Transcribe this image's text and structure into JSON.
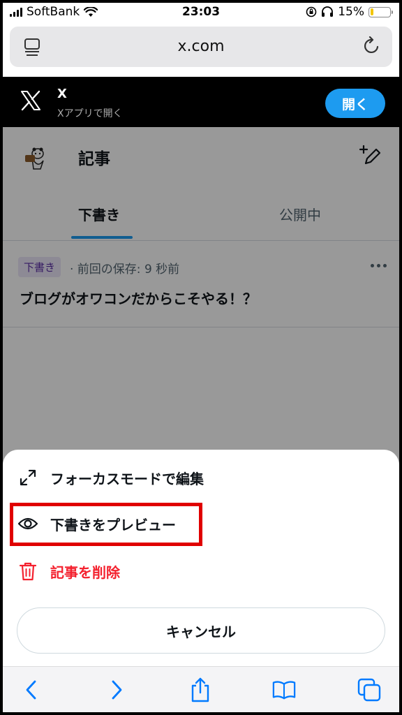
{
  "status_bar": {
    "carrier": "SoftBank",
    "time": "23:03",
    "battery": "15%",
    "battery_level": 0.15
  },
  "browser": {
    "url": "x.com"
  },
  "app_banner": {
    "title": "X",
    "subtitle": "Xアプリで開く",
    "open_label": "開く"
  },
  "page": {
    "title": "記事",
    "tabs": [
      {
        "label": "下書き",
        "active": true
      },
      {
        "label": "公開中",
        "active": false
      }
    ],
    "drafts": [
      {
        "badge": "下書き",
        "saved": "· 前回の保存: 9 秒前",
        "title": "ブログがオワコンだからこそやる！？"
      }
    ]
  },
  "sheet": {
    "items": [
      {
        "label": "フォーカスモードで編集",
        "icon": "expand-icon"
      },
      {
        "label": "下書きをプレビュー",
        "icon": "eye-icon"
      },
      {
        "label": "記事を削除",
        "icon": "trash-icon"
      }
    ],
    "cancel_label": "キャンセル"
  },
  "colors": {
    "accent": "#1d9bf0",
    "danger": "#f4212e",
    "highlight": "#e00000",
    "badge_bg": "#ece6f9",
    "safari_blue": "#007aff"
  }
}
